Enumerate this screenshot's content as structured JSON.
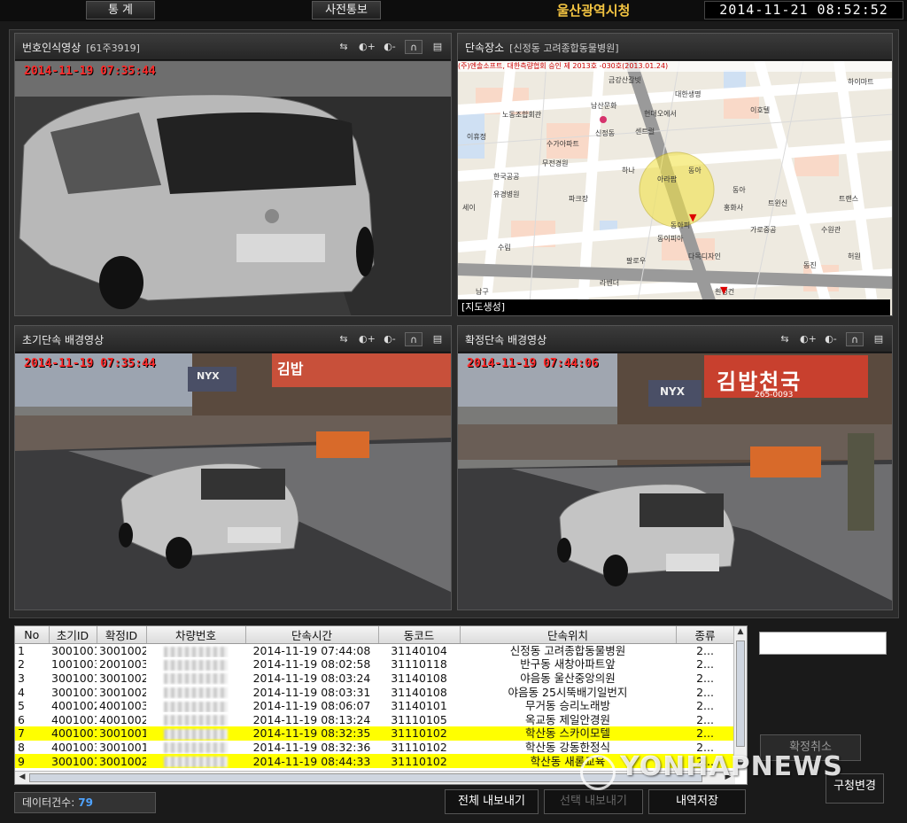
{
  "topbar": {
    "stats_button": "통 계",
    "notice_button": "사전통보",
    "city_title": "울산광역시청",
    "clock": "2014-11-21  08:52:52"
  },
  "panels": {
    "plate_video": {
      "title": "번호인식영상",
      "subtitle": "[61주3919]",
      "timestamp": "2014-11-19 07:35:44"
    },
    "location": {
      "title": "단속장소",
      "subtitle": "[신정동 고려종합동물병원]",
      "map_caption": "[지도생성]",
      "map_header": "(주)엔솔소프트, 대한측량협회 승인 제 2013호 -030호(2013.01.24)",
      "map_labels": [
        "금강산갈빗",
        "하이마트",
        "대한생명",
        "남산문화",
        "노동조합회관",
        "현대오에서",
        "신정동",
        "센트럴",
        "수가아파트",
        "이호텔",
        "이휴정",
        "무전경원",
        "한국공공",
        "하나",
        "동아",
        "파크장",
        "유경병원",
        "세이",
        "동아",
        "트윈신",
        "아라팝",
        "홍화사",
        "동아피",
        "가로중공",
        "수림",
        "팔로우",
        "라벤더",
        "동이피아",
        "다목디자인",
        "수원관",
        "트랜스",
        "동진",
        "허원",
        "남구",
        "흰정건"
      ]
    },
    "initial_bg": {
      "title": "초기단속 배경영상",
      "timestamp": "2014-11-19 07:35:44",
      "sign_top": "김밥",
      "sign_nyx": "NYX"
    },
    "confirm_bg": {
      "title": "확정단속 배경영상",
      "timestamp": "2014-11-19 07:44:06",
      "sign_top": "김밥천국",
      "sign_nyx": "NYX",
      "sign_phone": "265-0093"
    }
  },
  "tools": [
    "fit-icon",
    "brightness-up-icon",
    "brightness-down-icon",
    "headphones-icon",
    "save-icon"
  ],
  "table": {
    "headers": [
      "No",
      "초기ID",
      "확정ID",
      "차량번호",
      "단속시간",
      "동코드",
      "단속위치",
      "종류"
    ],
    "rows": [
      {
        "no": "1",
        "init": "3001001",
        "conf": "3001002",
        "time": "2014-11-19 07:44:08",
        "dong": "31140104",
        "loc": "신정동 고려종합동물병원",
        "kind": "2...",
        "hl": false
      },
      {
        "no": "2",
        "init": "1001003",
        "conf": "2001003",
        "time": "2014-11-19 08:02:58",
        "dong": "31110118",
        "loc": "반구동 새창아파트앞",
        "kind": "2...",
        "hl": false
      },
      {
        "no": "3",
        "init": "3001001",
        "conf": "3001002",
        "time": "2014-11-19 08:03:24",
        "dong": "31140108",
        "loc": "야음동 울산중앙의원",
        "kind": "2...",
        "hl": false
      },
      {
        "no": "4",
        "init": "3001001",
        "conf": "3001002",
        "time": "2014-11-19 08:03:31",
        "dong": "31140108",
        "loc": "야음동 25시뚝배기일번지",
        "kind": "2...",
        "hl": false
      },
      {
        "no": "5",
        "init": "4001002",
        "conf": "4001003",
        "time": "2014-11-19 08:06:07",
        "dong": "31140101",
        "loc": "무거동 승리노래방",
        "kind": "2...",
        "hl": false
      },
      {
        "no": "6",
        "init": "4001001",
        "conf": "4001002",
        "time": "2014-11-19 08:13:24",
        "dong": "31110105",
        "loc": "옥교동 제일안경원",
        "kind": "2...",
        "hl": false
      },
      {
        "no": "7",
        "init": "4001001",
        "conf": "3001001",
        "time": "2014-11-19 08:32:35",
        "dong": "31110102",
        "loc": "학산동 스카이모텔",
        "kind": "2...",
        "hl": true
      },
      {
        "no": "8",
        "init": "4001003",
        "conf": "3001001",
        "time": "2014-11-19 08:32:36",
        "dong": "31110102",
        "loc": "학산동 강동한정식",
        "kind": "2...",
        "hl": false
      },
      {
        "no": "9",
        "init": "3001001",
        "conf": "3001002",
        "time": "2014-11-19 08:44:33",
        "dong": "31110102",
        "loc": "학산동 새롬교육",
        "kind": "2...",
        "hl": true
      }
    ]
  },
  "right": {
    "cancel_confirm": "확정취소",
    "district_change": "구청변경"
  },
  "bottom": {
    "count_label": "데이터건수:",
    "count_value": "79",
    "export_all": "전체 내보내기",
    "export_selected": "선택 내보내기",
    "save_history": "내역저장"
  },
  "watermark": "YONHAPNEWS",
  "colors": {
    "highlight": "#ffff00",
    "timestamp": "#ff2a2a",
    "city_title": "#f4c542",
    "count": "#4fa3ff"
  }
}
